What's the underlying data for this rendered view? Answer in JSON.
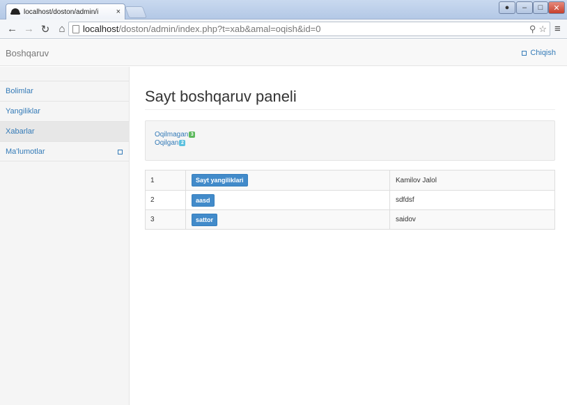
{
  "browser": {
    "tab_title": "localhost/doston/admin/i",
    "tab_close": "×",
    "url_host": "localhost",
    "url_path": "/doston/admin/index.php?t=xab&amal=oqish&id=0"
  },
  "navbar": {
    "brand": "Boshqaruv",
    "logout": "Chiqish"
  },
  "sidebar": {
    "items": [
      {
        "label": "Bolimlar"
      },
      {
        "label": "Yangiliklar"
      },
      {
        "label": "Xabarlar"
      },
      {
        "label": "Ma'lumotlar"
      }
    ]
  },
  "main": {
    "title": "Sayt boshqaruv paneli",
    "well": {
      "unread_label": "Oqilmagan",
      "unread_count": "3",
      "read_label": "Oqilgan",
      "read_count": "2"
    },
    "rows": [
      {
        "num": "1",
        "subject": "Sayt yangiliklari",
        "name": "Kamilov Jalol"
      },
      {
        "num": "2",
        "subject": "aasd",
        "name": "sdfdsf"
      },
      {
        "num": "3",
        "subject": "sattor",
        "name": "saidov"
      }
    ]
  },
  "colors": {
    "link": "#337ab7",
    "badge_green": "#5cb85c",
    "badge_blue": "#5bc0de",
    "primary_button": "#428bca"
  }
}
